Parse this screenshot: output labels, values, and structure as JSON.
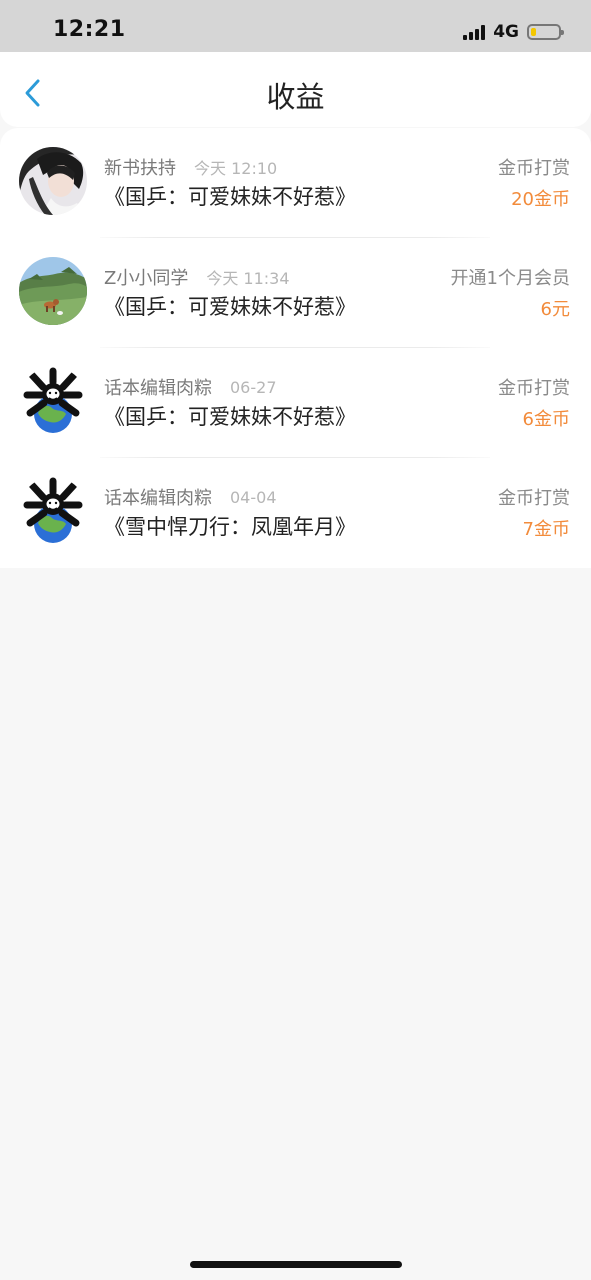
{
  "status_bar": {
    "time": "12:21",
    "network": "4G",
    "battery_level": 0.18,
    "signal_icon": "signal-bars-icon",
    "battery_icon": "battery-icon"
  },
  "header": {
    "title": "收益",
    "back_icon": "chevron-left-icon"
  },
  "records": [
    {
      "name": "新书扶持",
      "time": "今天 12:10",
      "book": "《国乒：可爱妹妹不好惹》",
      "type": "金币打赏",
      "amount": "20金币",
      "avatar_icon": "portrait-avatar"
    },
    {
      "name": "Z小小同学",
      "time": "今天 11:34",
      "book": "《国乒：可爱妹妹不好惹》",
      "type": "开通1个月会员",
      "amount": "6元",
      "avatar_icon": "landscape-dog-avatar"
    },
    {
      "name": "话本编辑肉粽",
      "time": "06-27",
      "book": "《国乒：可爱妹妹不好惹》",
      "type": "金币打赏",
      "amount": "6金币",
      "avatar_icon": "cartoon-earth-avatar"
    },
    {
      "name": "话本编辑肉粽",
      "time": "04-04",
      "book": "《雪中悍刀行：凤凰年月》",
      "type": "金币打赏",
      "amount": "7金币",
      "avatar_icon": "cartoon-earth-avatar"
    }
  ],
  "colors": {
    "accent": "#f28b3b",
    "back": "#2c9bd8",
    "background": "#f7f7f7"
  }
}
